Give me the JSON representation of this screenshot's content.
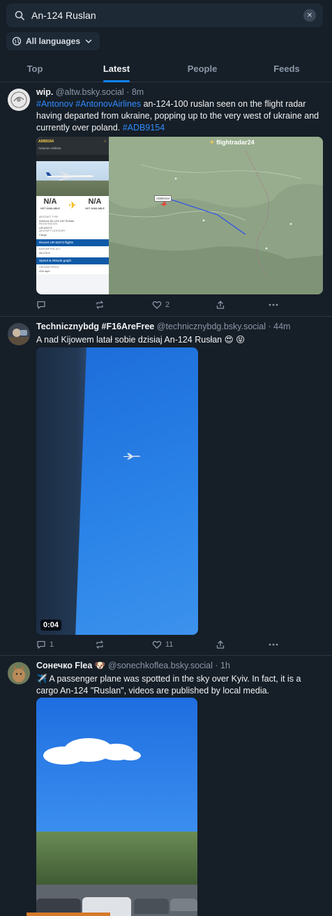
{
  "search": {
    "query": "An-124 Ruslan",
    "clear_glyph": "✕"
  },
  "language_filter": {
    "label": "All languages"
  },
  "tabs": [
    {
      "label": "Top"
    },
    {
      "label": "Latest"
    },
    {
      "label": "People"
    },
    {
      "label": "Feeds"
    }
  ],
  "colors": {
    "accent": "#1083fe",
    "link": "#2f8cff",
    "background": "#161e27"
  },
  "posts": [
    {
      "name": "wip.",
      "handle": "@altw.bsky.social",
      "time": "· 8m",
      "text_tags": [
        "#Antonov",
        "#AntonovAirlines"
      ],
      "text_main": "an-124-100 ruslan seen on the flight radar having departed from ukraine, popping up to the very west of ukraine and currently over poland.",
      "text_tag_end": "#ADB9154",
      "media": {
        "callsign": "ADB9154",
        "airline": "Antonov Airlines",
        "app": "flightradar24",
        "origin": "N/A",
        "destination": "N/A",
        "not_available": "NOT AVAILABLE",
        "aircraft_type": "Antonov An-124-100 Ruslan",
        "registration": "UR-82073",
        "category": "Cargo",
        "altitude": "28,075 ft",
        "speed": "426 mph",
        "section_flights": "Recent UR-82073 flights",
        "section_speed": "Speed & Altitude graph",
        "map_label": "ADB9154"
      },
      "replies": "",
      "reposts": "",
      "likes": "2"
    },
    {
      "name": "Technicznybdg #F16AreFree",
      "handle": "@technicznybdg.bsky.social",
      "time": "· 44m",
      "text": "A nad Kijowem latał sobie dzisiaj An-124 Rusłan  😍 😝",
      "duration": "0:04",
      "replies": "1",
      "reposts": "",
      "likes": "11"
    },
    {
      "name": "Сонечко Flea",
      "handle": "@sonechkoflea.bsky.social",
      "time": "· 1h",
      "text": "✈️ A passenger plane was spotted in the sky over Kyiv. In fact, it is a cargo An-124 \"Ruslan\", videos are published by local media."
    }
  ]
}
